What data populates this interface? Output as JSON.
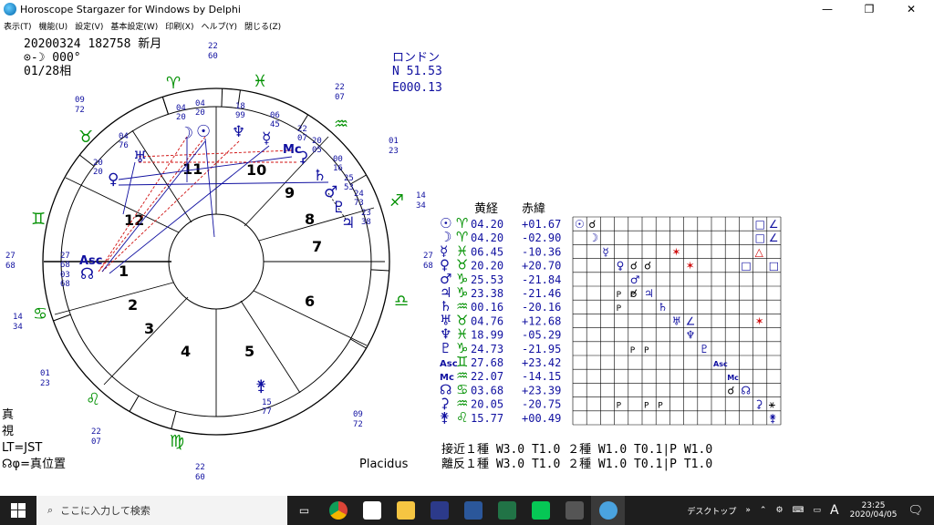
{
  "window": {
    "title": "Horoscope Stargazer for Windows by Delphi",
    "min": "—",
    "max": "❐",
    "close": "✕"
  },
  "menu": [
    {
      "label": "表示(T)"
    },
    {
      "label": "機能(U)"
    },
    {
      "label": "設定(V)"
    },
    {
      "label": "基本設定(W)"
    },
    {
      "label": "印刷(X)"
    },
    {
      "label": "ヘルプ(Y)"
    },
    {
      "label": "閉じる(Z)"
    }
  ],
  "info": {
    "datetime": "20200324 182758 新月",
    "aspect": "⊙-☽ 000°",
    "phase": "01/28相",
    "place": "ロンドン",
    "lat": "N 51.53",
    "lon": "E000.13",
    "bottom_left": [
      "真",
      "視",
      "LT=JST",
      "☊φ=真位置"
    ],
    "house_system": "Placidus"
  },
  "wheel": {
    "houses": [
      "1",
      "2",
      "3",
      "4",
      "5",
      "6",
      "7",
      "8",
      "9",
      "10",
      "11",
      "12"
    ],
    "signs": [
      "♈",
      "♉",
      "♊",
      "♋",
      "♌",
      "♍",
      "♎",
      "♏",
      "♐",
      "♑",
      "♒",
      "♓"
    ],
    "cusp_labels": [
      {
        "deg": "27",
        "min": "68",
        "side": "left"
      },
      {
        "deg": "27",
        "min": "68",
        "side": "right"
      },
      {
        "deg": "22",
        "min": "60",
        "side": "top"
      },
      {
        "deg": "22",
        "min": "60",
        "side": "bottom"
      },
      {
        "deg": "14",
        "min": "34",
        "side": "left"
      },
      {
        "deg": "14",
        "min": "34",
        "side": "right"
      },
      {
        "deg": "01",
        "min": "23",
        "side": "left"
      },
      {
        "deg": "01",
        "min": "23",
        "side": "right"
      },
      {
        "deg": "09",
        "min": "72",
        "side": "left"
      },
      {
        "deg": "09",
        "min": "72",
        "side": "right"
      },
      {
        "deg": "22",
        "min": "07",
        "side": "left"
      },
      {
        "deg": "22",
        "min": "07",
        "side": "right"
      }
    ],
    "planets": [
      {
        "sym": "☉",
        "deg": "04",
        "min": "20"
      },
      {
        "sym": "☽",
        "deg": "04",
        "min": "20"
      },
      {
        "sym": "♆",
        "deg": "18",
        "min": "99"
      },
      {
        "sym": "☿",
        "deg": "06",
        "min": "45"
      },
      {
        "sym": "Mc",
        "deg": "22",
        "min": "07"
      },
      {
        "sym": "⚳",
        "deg": "20",
        "min": "05"
      },
      {
        "sym": "♄",
        "deg": "00",
        "min": "16"
      },
      {
        "sym": "♂",
        "deg": "25",
        "min": "53"
      },
      {
        "sym": "♇",
        "deg": "24",
        "min": "73"
      },
      {
        "sym": "♃",
        "deg": "23",
        "min": "38"
      },
      {
        "sym": "♀",
        "deg": "20",
        "min": "20"
      },
      {
        "sym": "♅",
        "deg": "04",
        "min": "76"
      },
      {
        "sym": "Asc",
        "deg": "27",
        "min": "68"
      },
      {
        "sym": "☊",
        "deg": "03",
        "min": "68"
      },
      {
        "sym": "⚵",
        "deg": "15",
        "min": "77"
      }
    ]
  },
  "table": {
    "head1": "黄経",
    "head2": "赤緯",
    "rows": [
      {
        "p": "☉",
        "s": "♈",
        "lon": "04.20",
        "dec": "+01.67"
      },
      {
        "p": "☽",
        "s": "♈",
        "lon": "04.20",
        "dec": "-02.90"
      },
      {
        "p": "☿",
        "s": "♓",
        "lon": "06.45",
        "dec": "-10.36"
      },
      {
        "p": "♀",
        "s": "♉",
        "lon": "20.20",
        "dec": "+20.70"
      },
      {
        "p": "♂",
        "s": "♑",
        "lon": "25.53",
        "dec": "-21.84"
      },
      {
        "p": "♃",
        "s": "♑",
        "lon": "23.38",
        "dec": "-21.46"
      },
      {
        "p": "♄",
        "s": "♒",
        "lon": "00.16",
        "dec": "-20.16"
      },
      {
        "p": "♅",
        "s": "♉",
        "lon": "04.76",
        "dec": "+12.68"
      },
      {
        "p": "♆",
        "s": "♓",
        "lon": "18.99",
        "dec": "-05.29"
      },
      {
        "p": "♇",
        "s": "♑",
        "lon": "24.73",
        "dec": "-21.95"
      },
      {
        "p": "Asc",
        "s": "♊",
        "lon": "27.68",
        "dec": "+23.42"
      },
      {
        "p": "Mc",
        "s": "♒",
        "lon": "22.07",
        "dec": "-14.15"
      },
      {
        "p": "☊",
        "s": "♋",
        "lon": "03.68",
        "dec": "+23.39"
      },
      {
        "p": "⚳",
        "s": "♒",
        "lon": "20.05",
        "dec": "-20.75"
      },
      {
        "p": "⚵",
        "s": "♌",
        "lon": "15.77",
        "dec": "+00.49"
      }
    ],
    "orb1": "接近１種 W3.0 T1.0 ２種 W1.0 T0.1|P W1.0",
    "orb2": "離反１種 W3.0 T1.0 ２種 W1.0 T0.1|P T1.0"
  },
  "taskbar": {
    "search_placeholder": "ここに入力して検索",
    "desktop": "デスクトップ",
    "ime": "A",
    "time": "23:25",
    "date": "2020/04/05"
  },
  "colors": {
    "blue": "#1010a0",
    "green": "#009000",
    "red": "#d01010",
    "grid": "#000000"
  }
}
